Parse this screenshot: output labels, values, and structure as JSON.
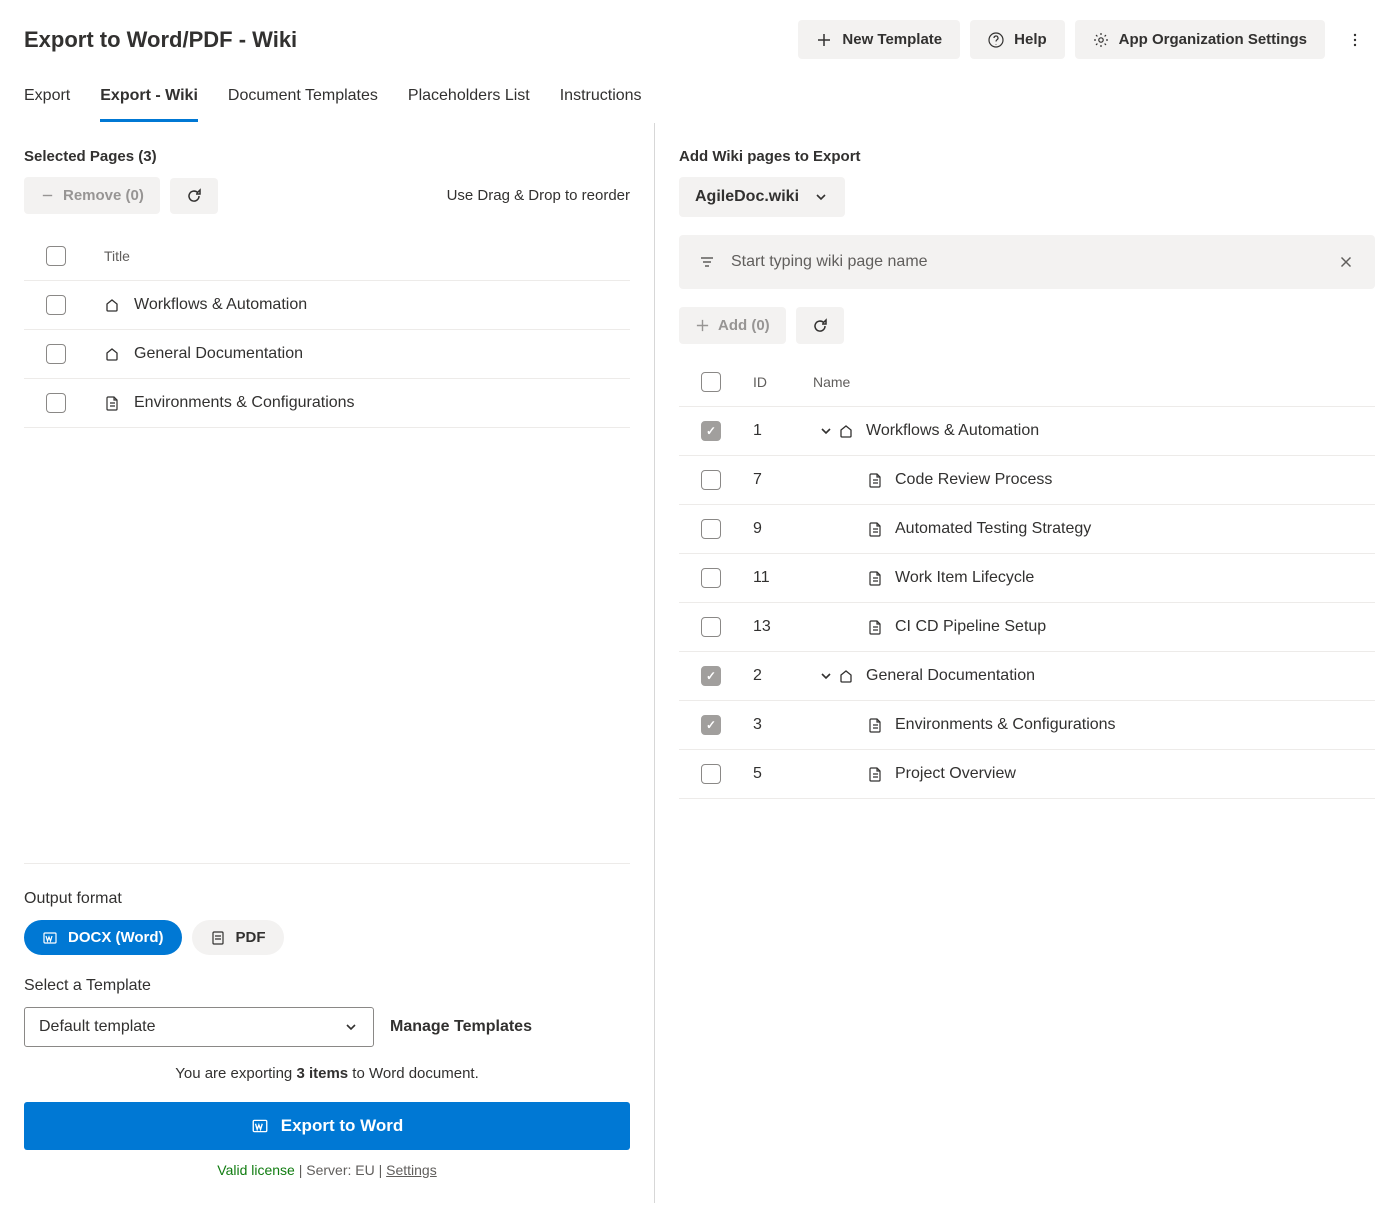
{
  "header": {
    "title": "Export to Word/PDF - Wiki",
    "new_template": "New Template",
    "help": "Help",
    "settings": "App Organization Settings"
  },
  "tabs": {
    "export": "Export",
    "export_wiki": "Export - Wiki",
    "doc_templates": "Document Templates",
    "placeholders": "Placeholders List",
    "instructions": "Instructions"
  },
  "left": {
    "selected_label": "Selected Pages (3)",
    "remove": "Remove (0)",
    "reorder_hint": "Use Drag & Drop to reorder",
    "col_title": "Title",
    "rows": [
      {
        "icon": "wiki",
        "title": "Workflows & Automation"
      },
      {
        "icon": "wiki",
        "title": "General Documentation"
      },
      {
        "icon": "page",
        "title": "Environments & Configurations"
      }
    ],
    "output_format": "Output format",
    "docx": "DOCX (Word)",
    "pdf": "PDF",
    "select_template_label": "Select a Template",
    "template_value": "Default template",
    "manage_templates": "Manage Templates",
    "export_info_pre": "You are exporting ",
    "export_info_count": "3 items",
    "export_info_post": " to Word document.",
    "export_button": "Export to Word",
    "valid_license": "Valid license",
    "server": " | Server: EU | ",
    "settings_link": "Settings"
  },
  "right": {
    "add_label": "Add Wiki pages to Export",
    "wiki_name": "AgileDoc.wiki",
    "search_placeholder": "Start typing wiki page name",
    "add_button": "Add (0)",
    "col_id": "ID",
    "col_name": "Name",
    "rows": [
      {
        "checked": true,
        "id": "1",
        "expand": true,
        "icon": "wiki",
        "indent": 0,
        "name": "Workflows & Automation"
      },
      {
        "checked": false,
        "id": "7",
        "expand": false,
        "icon": "page",
        "indent": 1,
        "name": "Code Review Process"
      },
      {
        "checked": false,
        "id": "9",
        "expand": false,
        "icon": "page",
        "indent": 1,
        "name": "Automated Testing Strategy"
      },
      {
        "checked": false,
        "id": "11",
        "expand": false,
        "icon": "page",
        "indent": 1,
        "name": "Work Item Lifecycle"
      },
      {
        "checked": false,
        "id": "13",
        "expand": false,
        "icon": "page",
        "indent": 1,
        "name": "CI CD Pipeline Setup"
      },
      {
        "checked": true,
        "id": "2",
        "expand": true,
        "icon": "wiki",
        "indent": 0,
        "name": "General Documentation"
      },
      {
        "checked": true,
        "id": "3",
        "expand": false,
        "icon": "page",
        "indent": 1,
        "name": "Environments & Configurations"
      },
      {
        "checked": false,
        "id": "5",
        "expand": false,
        "icon": "page",
        "indent": 1,
        "name": "Project Overview"
      }
    ]
  }
}
